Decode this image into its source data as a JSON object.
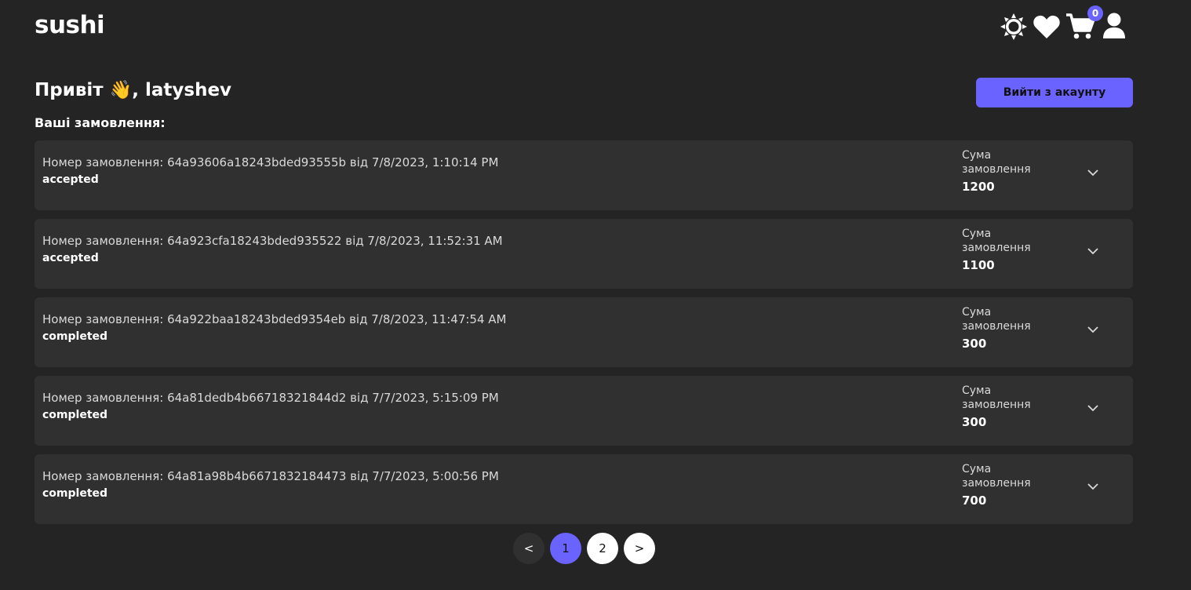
{
  "header": {
    "logo": "sushi",
    "cart_count": "0"
  },
  "greeting": "Привіт 👋, latyshev",
  "logout_label": "Вийти з акаунту",
  "orders_title": "Ваші замовлення:",
  "orders": [
    {
      "info": "Номер замовлення: 64a93606a18243bded93555b від 7/8/2023, 1:10:14 PM",
      "status": "accepted",
      "sum_label": "Сума замовлення",
      "sum": "1200"
    },
    {
      "info": "Номер замовлення: 64a923cfa18243bded935522 від 7/8/2023, 11:52:31 AM",
      "status": "accepted",
      "sum_label": "Сума замовлення",
      "sum": "1100"
    },
    {
      "info": "Номер замовлення: 64a922baa18243bded9354eb від 7/8/2023, 11:47:54 AM",
      "status": "completed",
      "sum_label": "Сума замовлення",
      "sum": "300"
    },
    {
      "info": "Номер замовлення: 64a81dedb4b66718321844d2 від 7/7/2023, 5:15:09 PM",
      "status": "completed",
      "sum_label": "Сума замовлення",
      "sum": "300"
    },
    {
      "info": "Номер замовлення: 64a81a98b4b6671832184473 від 7/7/2023, 5:00:56 PM",
      "status": "completed",
      "sum_label": "Сума замовлення",
      "sum": "700"
    }
  ],
  "pagination": {
    "prev": "<",
    "pages": [
      "1",
      "2"
    ],
    "current": "1",
    "next": ">"
  },
  "icons": [
    "sun-icon",
    "heart-icon",
    "cart-icon",
    "user-icon",
    "chevron-down-icon"
  ],
  "colors": {
    "accent": "#6b63ff",
    "background": "#242424",
    "card": "#303030"
  }
}
